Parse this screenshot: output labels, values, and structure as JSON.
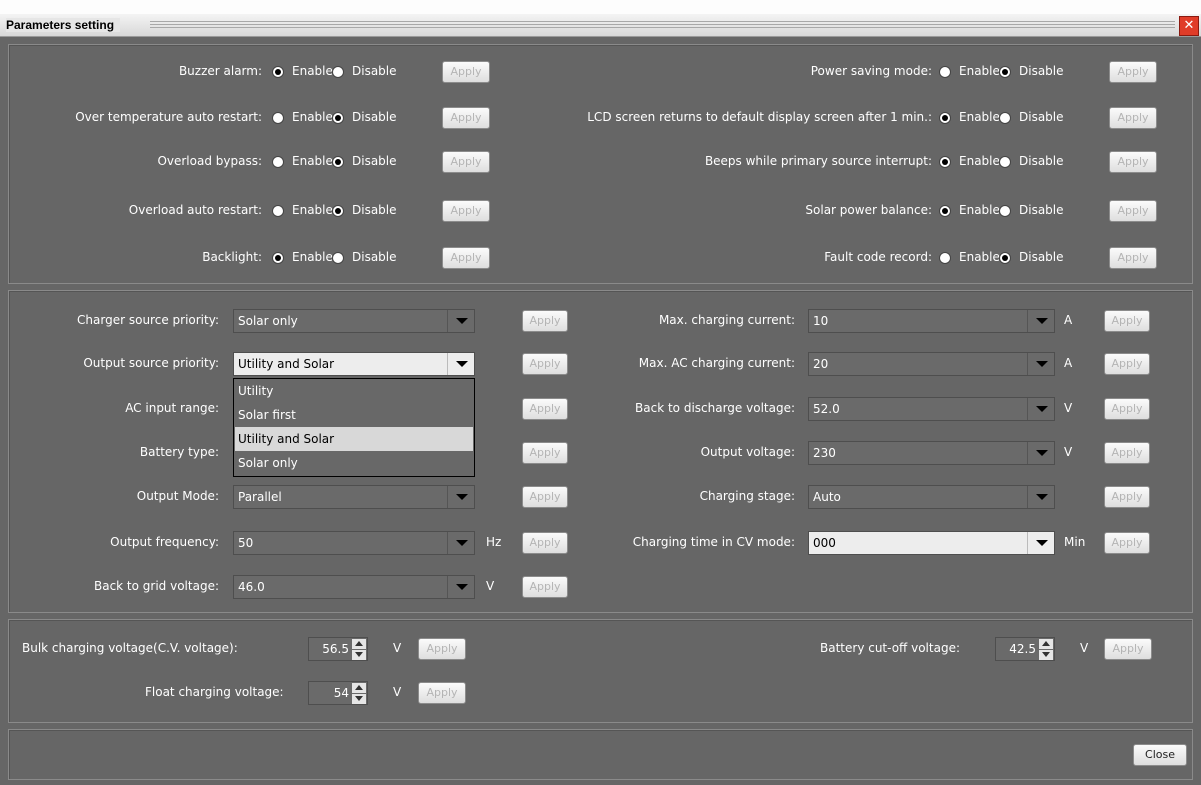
{
  "window": {
    "title": "Parameters setting",
    "close_icon": "close-icon"
  },
  "toggle_options": {
    "enable": "Enable",
    "disable": "Disable",
    "apply": "Apply"
  },
  "toggles_left": [
    {
      "label": "Buzzer alarm:",
      "value": "Enable"
    },
    {
      "label": "Over temperature auto restart:",
      "value": "Disable"
    },
    {
      "label": "Overload bypass:",
      "value": "Disable"
    },
    {
      "label": "Overload auto restart:",
      "value": "Disable"
    },
    {
      "label": "Backlight:",
      "value": "Enable"
    }
  ],
  "toggles_right": [
    {
      "label": "Power saving mode:",
      "value": "Disable"
    },
    {
      "label": "LCD screen returns to default display screen after 1 min.:",
      "value": "Enable"
    },
    {
      "label": "Beeps while primary source interrupt:",
      "value": "Enable"
    },
    {
      "label": "Solar power balance:",
      "value": "Enable"
    },
    {
      "label": "Fault code record:",
      "value": "Disable"
    }
  ],
  "selects_left": [
    {
      "label": "Charger source priority:",
      "value": "Solar only",
      "unit": ""
    },
    {
      "label": "Output source priority:",
      "value": "Utility and Solar",
      "unit": ""
    },
    {
      "label": "AC input range:",
      "value": "",
      "unit": ""
    },
    {
      "label": "Battery type:",
      "value": "",
      "unit": ""
    },
    {
      "label": "Output Mode:",
      "value": "Parallel",
      "unit": ""
    },
    {
      "label": "Output frequency:",
      "value": "50",
      "unit": "Hz"
    },
    {
      "label": "Back to grid voltage:",
      "value": "46.0",
      "unit": "V"
    }
  ],
  "selects_right": [
    {
      "label": "Max. charging current:",
      "value": "10",
      "unit": "A"
    },
    {
      "label": "Max. AC charging current:",
      "value": "20",
      "unit": "A"
    },
    {
      "label": "Back to discharge voltage:",
      "value": "52.0",
      "unit": "V"
    },
    {
      "label": "Output voltage:",
      "value": "230",
      "unit": "V"
    },
    {
      "label": "Charging stage:",
      "value": "Auto",
      "unit": ""
    },
    {
      "label": "Charging time in CV mode:",
      "value": "000",
      "unit": "Min"
    }
  ],
  "output_source_dropdown": {
    "options": [
      "Utility",
      "Solar first",
      "Utility and Solar",
      "Solar only"
    ],
    "highlighted": "Utility and Solar"
  },
  "spinners": [
    {
      "label": "Bulk charging voltage(C.V. voltage):",
      "value": "56.5",
      "unit": "V"
    },
    {
      "label": "Float charging voltage:",
      "value": "54",
      "unit": "V"
    },
    {
      "label": "Battery cut-off voltage:",
      "value": "42.5",
      "unit": "V"
    }
  ],
  "footer": {
    "close_label": "Close"
  }
}
